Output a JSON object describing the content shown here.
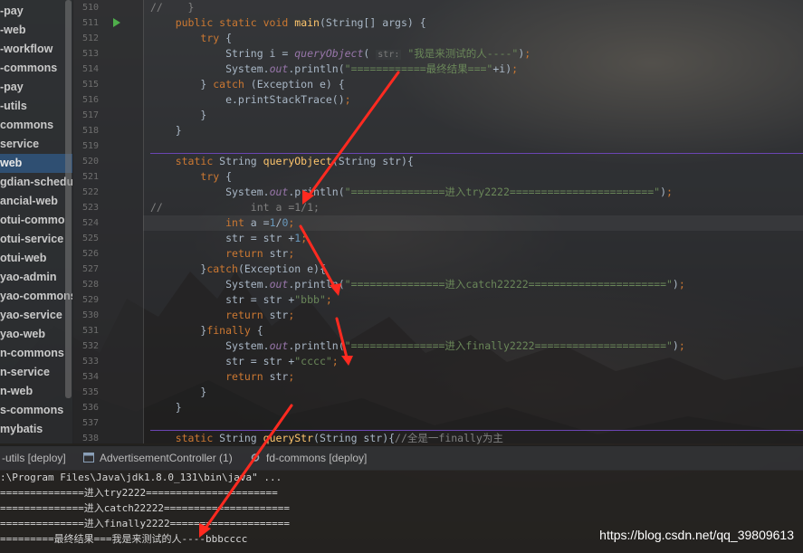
{
  "sidebar": {
    "items": [
      "-pay",
      "-web",
      "-workflow",
      "-commons",
      "-pay",
      "-utils",
      "commons",
      "service",
      "web",
      "gdian-schedu",
      "ancial-web",
      "otui-commo",
      "otui-service",
      "otui-web",
      "yao-admin",
      "yao-commons",
      "yao-service",
      "yao-web",
      "n-commons",
      "n-service",
      "n-web",
      "s-commons",
      "mybatis"
    ],
    "selected_index": 8
  },
  "editor": {
    "line_numbers": [
      "510",
      "511",
      "512",
      "513",
      "514",
      "515",
      "516",
      "517",
      "518",
      "519",
      "520",
      "521",
      "522",
      "523",
      "524",
      "525",
      "526",
      "527",
      "528",
      "529",
      "530",
      "531",
      "532",
      "533",
      "534",
      "535",
      "536",
      "537",
      "538"
    ],
    "param_hint": "str:",
    "strings": {
      "s1": "\"我是来测试的人----\"",
      "s2": "\"============最终结果===\"",
      "s3": "\"===============进入try2222=======================\"",
      "s4": "\"===============进入catch22222======================\"",
      "s5": "\"bbb\"",
      "s6": "\"===============进入finally2222=====================\"",
      "s7": "\"cccc\"",
      "c1": "//全是一finally为主"
    }
  },
  "run_panel": {
    "tabs": [
      "-utils [deploy]",
      "AdvertisementController (1)",
      "fd-commons [deploy]"
    ],
    "console_lines": [
      ":\\Program Files\\Java\\jdk1.8.0_131\\bin\\java\" ...",
      "==============进入try2222======================",
      "==============进入catch22222=====================",
      "==============进入finally2222====================",
      "=========最终结果===我是来测试的人----bbbcccc"
    ]
  },
  "watermark": "https://blog.csdn.net/qq_39809613",
  "colors": {
    "keyword": "#cc7832",
    "method": "#ffc66d",
    "string": "#6a8759",
    "annotation_arrow": "#ff2a20",
    "selection": "#2f4f72"
  }
}
